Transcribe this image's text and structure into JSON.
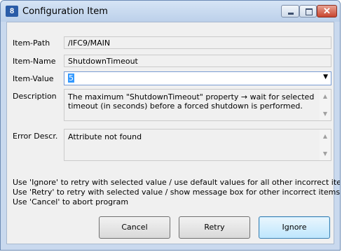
{
  "window": {
    "title": "Configuration Item",
    "app_icon_text": "8"
  },
  "fields": {
    "item_path": {
      "label": "Item-Path",
      "value": "/IFC9/MAIN"
    },
    "item_name": {
      "label": "Item-Name",
      "value": "ShutdownTimeout"
    },
    "item_value": {
      "label": "Item-Value",
      "value": "5"
    },
    "description": {
      "label": "Description",
      "value": "The maximum \"ShutdownTimeout\" property → wait for selected timeout (in seconds) before a forced shutdown is performed."
    },
    "error": {
      "label": "Error Descr.",
      "value": "Attribute not found"
    }
  },
  "help_lines": [
    "Use 'Ignore' to retry with selected value / use default values for all other incorrect items",
    "Use 'Retry' to retry with selected value / show message box for other incorrect items",
    "Use 'Cancel' to abort program"
  ],
  "buttons": {
    "cancel": "Cancel",
    "retry": "Retry",
    "ignore": "Ignore"
  },
  "icons": {
    "minimize": "minimize-icon",
    "maximize": "maximize-icon",
    "close": "close-icon",
    "dropdown": "chevron-down-icon",
    "scroll_up": "scroll-up-icon",
    "scroll_down": "scroll-down-icon"
  },
  "colors": {
    "title_bar": "#c9d9ee",
    "close_button": "#c8452f",
    "selection": "#3399ff"
  }
}
